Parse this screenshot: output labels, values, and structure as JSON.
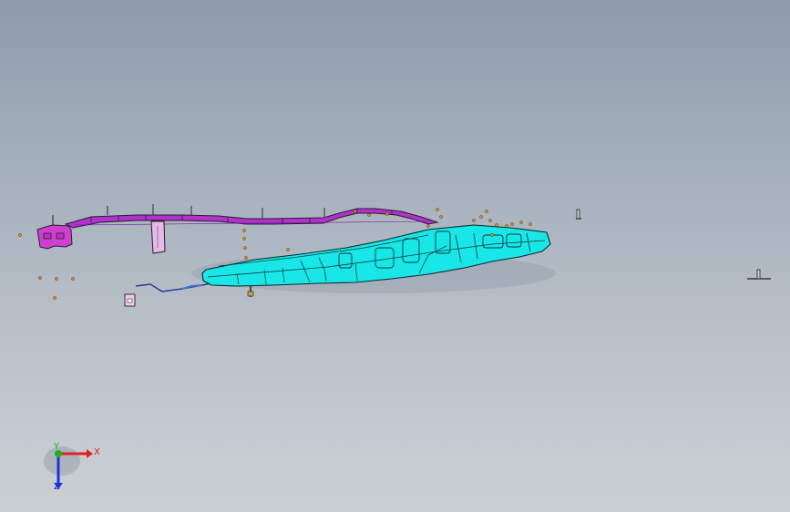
{
  "viewport": {
    "background_top": "#8f9bad",
    "background_bottom": "#cbd0d4"
  },
  "parts": {
    "frame_rail_color": "#b033cc",
    "bracket_color": "#d040d0",
    "tank_color": "#19e6e6",
    "fastener_color": "#d48a2a"
  },
  "triad": {
    "x_label": "X",
    "y_label": "Y",
    "z_label": "Z",
    "x_color": "#e02020",
    "y_color": "#20b020",
    "z_color": "#2030e0"
  }
}
